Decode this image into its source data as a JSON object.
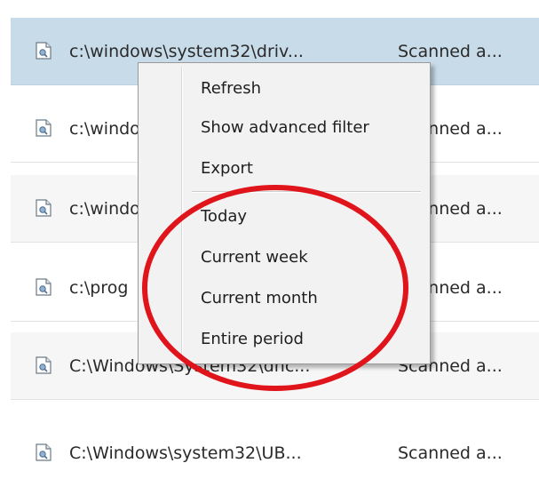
{
  "rows": [
    {
      "icon": "file-icon",
      "path": "c:\\windows\\system32\\driv...",
      "status": "Scanned a..."
    },
    {
      "icon": "file-icon",
      "path": "c:\\windows",
      "status": "Scanned a..."
    },
    {
      "icon": "file-icon",
      "path": "c:\\windows",
      "status": "Scanned a..."
    },
    {
      "icon": "file-icon",
      "path": "c:\\prog",
      "status": "Scanned a..."
    },
    {
      "icon": "file-icon",
      "path": "C:\\Windows\\System32\\dhc...",
      "status": "Scanned a..."
    },
    {
      "icon": "file-icon",
      "path": "C:\\Windows\\system32\\UB...",
      "status": "Scanned a..."
    }
  ],
  "context_menu": {
    "items": [
      "Refresh",
      "Show advanced filter",
      "Export"
    ],
    "period_items": [
      "Today",
      "Current week",
      "Current month",
      "Entire period"
    ]
  },
  "colors": {
    "selected_row": "#c8dbe9",
    "annotation_ring": "#e0141b"
  }
}
